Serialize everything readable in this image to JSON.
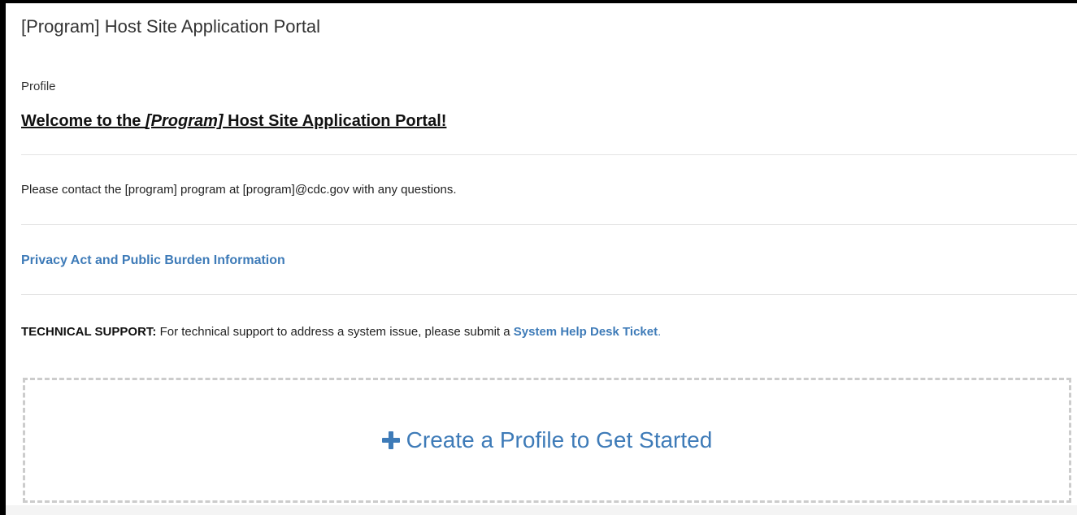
{
  "page": {
    "title": "[Program] Host Site Application Portal",
    "section_label": "Profile"
  },
  "welcome": {
    "prefix": "Welcome to the ",
    "program": "[Program]",
    "suffix": " Host Site Application Portal!"
  },
  "contact": {
    "text": "Please contact the [program] program at [program]@cdc.gov with any questions."
  },
  "privacy": {
    "link_text": "Privacy Act and Public Burden Information"
  },
  "tech_support": {
    "label": "TECHNICAL SUPPORT:",
    "text": " For technical support to address a system issue, please submit a ",
    "link_text": "System Help Desk Ticket",
    "period": "."
  },
  "create_profile": {
    "label": "Create a Profile to Get Started",
    "icon": "plus-icon"
  },
  "colors": {
    "link": "#3e7bb8",
    "border": "#000000",
    "dashed_border": "#cccccc"
  }
}
